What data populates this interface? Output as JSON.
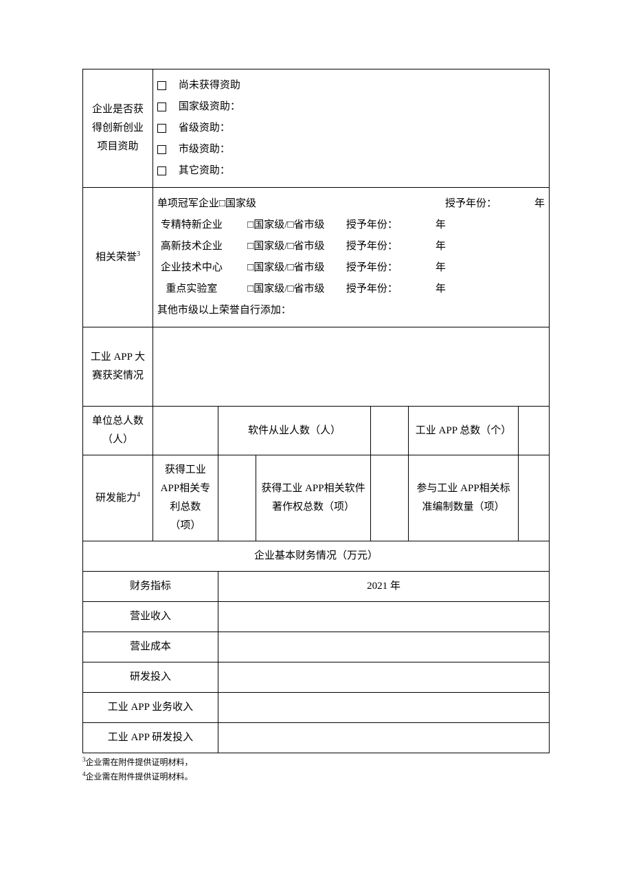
{
  "row1": {
    "label": "企业是否获得创新创业项目资助",
    "options": [
      "尚未获得资助",
      "国家级资助：",
      "省级资助：",
      "市级资助：",
      "其它资助："
    ]
  },
  "row2": {
    "label": "相关荣誉",
    "label_sup": "3",
    "year_label": "授予年份：",
    "year_unit": "年",
    "honors": [
      {
        "name": "单项冠军企业",
        "first_level": "□国家级",
        "levels": ""
      },
      {
        "name": "专精特新企业",
        "first_level": "",
        "levels": "□国家级/□省市级"
      },
      {
        "name": "高新技术企业",
        "first_level": "",
        "levels": "□国家级/□省市级"
      },
      {
        "name": "企业技术中心",
        "first_level": "",
        "levels": "□国家级/□省市级"
      },
      {
        "name": "重点实验室",
        "first_level": "",
        "levels": "□国家级/□省市级"
      }
    ],
    "extra": "其他市级以上荣誉自行添加："
  },
  "row3": {
    "label": "工业 APP 大赛获奖情况"
  },
  "row4": {
    "c1": "单位总人数（人）",
    "c2": "软件从业人数（人）",
    "c3": "工业 APP 总数（个）"
  },
  "row5": {
    "label": "研发能力",
    "label_sup": "4",
    "c1": "获得工业 APP相关专利总数（项）",
    "c2": "获得工业 APP相关软件著作权总数（项）",
    "c3": "参与工业 APP相关标准编制数量（项）"
  },
  "fin": {
    "header": "企业基本财务情况（万元）",
    "col_label": "财务指标",
    "year": "2021 年",
    "rows": [
      "营业收入",
      "营业成本",
      "研发投入",
      "工业 APP 业务收入",
      "工业 APP 研发投入"
    ]
  },
  "footnotes": {
    "f3_sup": "3",
    "f3_text": "企业需在附件提供证明材料，",
    "f4_sup": "4",
    "f4_text": "企业需在附件提供证明材料。"
  }
}
